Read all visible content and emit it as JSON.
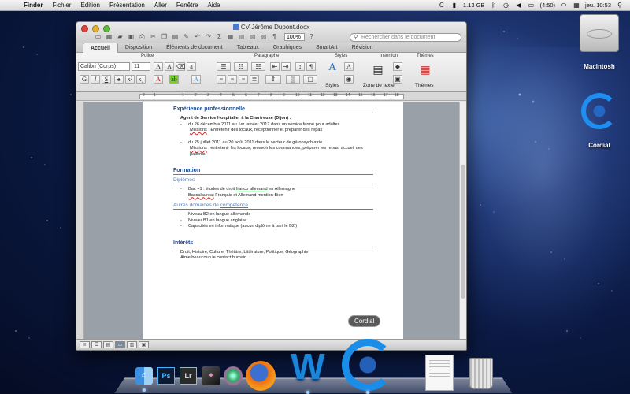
{
  "menubar": {
    "items": [
      "Finder",
      "Fichier",
      "Édition",
      "Présentation",
      "Aller",
      "Fenêtre",
      "Aide"
    ],
    "battery": "1.13 GB",
    "time_remaining": "(4:50)",
    "clock": "jeu. 10:53"
  },
  "desktop": {
    "hd_label": "Macintosh",
    "cordial_label": "Cordial"
  },
  "window": {
    "title": "CV Jérôme Dupont.docx",
    "zoom": "100%",
    "search_placeholder": "Rechercher dans le document",
    "tabs": [
      "Accueil",
      "Disposition",
      "Éléments de document",
      "Tableaux",
      "Graphiques",
      "SmartArt",
      "Révision"
    ],
    "groups": {
      "police": "Police",
      "paragraphe": "Paragraphe",
      "styles": "Styles",
      "insertion": "Insertion",
      "themes": "Thèmes"
    },
    "font_name": "Calibri (Corps)",
    "font_size": "11",
    "styles_caption": "Styles",
    "textbox_caption": "Zone de texte",
    "themes_caption": "Thèmes",
    "ruler_numbers": [
      "2",
      "1",
      "1",
      "2",
      "3",
      "4",
      "5",
      "6",
      "7",
      "8",
      "9",
      "10",
      "11",
      "12",
      "13",
      "14",
      "15",
      "16",
      "17",
      "18"
    ]
  },
  "document": {
    "experience_title": "Expérience professionnelle",
    "job_title": "Agent de Service Hospitalier à la Chartreuse (Dijon) :",
    "job1_dates": "du 26 décembre 2011 au 1er janvier 2012 dans un service fermé pour adultes",
    "job1_missions_label": "Missions",
    "job1_missions": " : Entretenir des locaux, réceptionner et préparer des repas",
    "job2_dates": "du 25 juillet 2011 au 20 août 2011 dans le secteur de géropsychiatrie.",
    "job2_missions_label": "Missions",
    "job2_missions": " : entretenir les locaux, recevoir les commandes, préparer les repas, accueil des",
    "job2_missions_cont": "patients",
    "formation_title": "Formation",
    "diplomes_title": "Diplômes",
    "bac_pre": "Bac +1 : études de droit ",
    "bac_link": "franco allemand",
    "bac_post": " en Allemagne",
    "baccalaureat": "Baccalauréat",
    "baccalaureat_post": " Français et Allemand mention Bien",
    "autres_pre": "Autres domaines de ",
    "autres_link": "compétence",
    "skills": [
      "Niveau B2 en langue allemande",
      "Niveau B1 en langue anglaise",
      "Capacités en informatique (aucun diplôme à part le B2i)"
    ],
    "interets_title": "Intérêts",
    "interets_1": "Droit, Histoire, Culture, Théâtre, Littérature, Politique, Géographie",
    "interets_2": "Aime beaucoup le contact humain"
  },
  "dock": {
    "tooltip": "Cordial",
    "finder_glyph": "☺",
    "ps": "Ps",
    "lr": "Lr",
    "word_glyph": "W"
  }
}
